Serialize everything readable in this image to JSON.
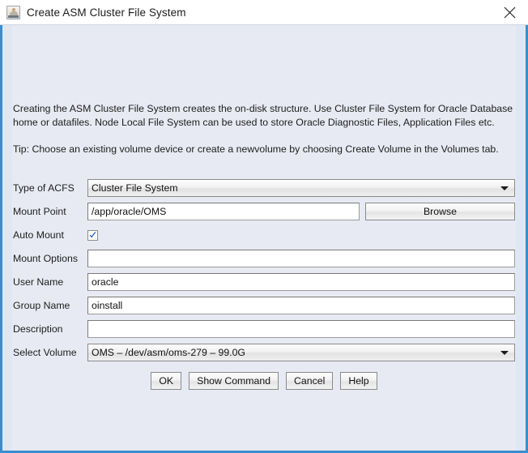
{
  "window": {
    "title": "Create ASM Cluster File System",
    "icon": "asm-cluster-icon",
    "close_label": "close-icon"
  },
  "description": {
    "line1": "Creating the ASM Cluster File System creates the on-disk structure. Use Cluster File System for Oracle Database",
    "line2": "home or datafiles. Node Local File System can be used to store Oracle Diagnostic Files, Application Files etc.",
    "tip": "Tip: Choose an existing volume device or create a newvolume by choosing Create Volume in the Volumes tab."
  },
  "form": {
    "type_of_acfs": {
      "label": "Type of ACFS",
      "value": "Cluster File System"
    },
    "mount_point": {
      "label": "Mount Point",
      "value": "/app/oracle/OMS",
      "placeholder": "",
      "browse_label": "Browse"
    },
    "auto_mount": {
      "label": "Auto Mount",
      "checked": true
    },
    "mount_options": {
      "label": "Mount Options",
      "value": "",
      "placeholder": ""
    },
    "user_name": {
      "label": "User Name",
      "value": "oracle",
      "placeholder": ""
    },
    "group_name": {
      "label": "Group Name",
      "value": "oinstall",
      "placeholder": ""
    },
    "description_field": {
      "label": "Description",
      "value": "",
      "placeholder": ""
    },
    "select_volume": {
      "label": "Select Volume",
      "value": "OMS – /dev/asm/oms-279 – 99.0G"
    }
  },
  "buttons": {
    "ok": "OK",
    "show_command": "Show Command",
    "cancel": "Cancel",
    "help": "Help"
  },
  "colors": {
    "accent_border": "#3c8dcd",
    "content_bg": "#e8eaf3",
    "check_blue": "#1f5fbf"
  }
}
